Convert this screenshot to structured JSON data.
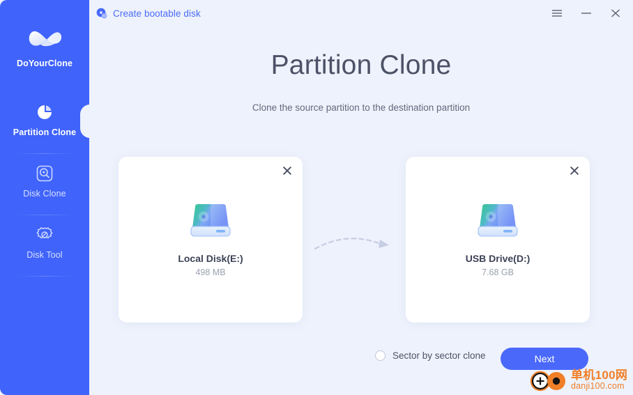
{
  "window": {
    "titlebar_action": {
      "icon": "iso-disc-icon",
      "label": "Create bootable disk"
    },
    "controls": [
      {
        "name": "menu-button",
        "icon": "hamburger-menu-icon"
      },
      {
        "name": "minimize-button",
        "icon": "minimize-icon"
      },
      {
        "name": "close-button",
        "icon": "close-icon"
      }
    ]
  },
  "sidebar": {
    "brand": {
      "name": "DoYourClone",
      "logo_icon": "infinity-ribbon-logo"
    },
    "background_color": "#3f63fb",
    "items": [
      {
        "label": "Partition Clone",
        "icon": "pie-chart-icon",
        "active": true
      },
      {
        "label": "Disk Clone",
        "icon": "disk-search-icon",
        "active": false
      },
      {
        "label": "Disk Tool",
        "icon": "gear-icon",
        "active": false
      }
    ]
  },
  "main": {
    "title": "Partition Clone",
    "subtitle": "Clone the source partition to the destination partition",
    "cards": [
      {
        "role": "source",
        "name": "Local Disk(E:)",
        "size": "498 MB",
        "icon": "hard-drive-icon",
        "close_icon": "close-icon"
      },
      {
        "role": "destination",
        "name": "USB Drive(D:)",
        "size": "7.68 GB",
        "icon": "hard-drive-icon",
        "close_icon": "close-icon"
      }
    ],
    "flow_arrow_icon": "dashed-curved-arrow-icon"
  },
  "footer": {
    "sector_option": {
      "label": "Sector by sector clone",
      "checked": false
    },
    "next_label": "Next"
  },
  "watermark": {
    "cn_text": "单机100网",
    "en_text": "danji100.com",
    "color": "#f07f28"
  },
  "colors": {
    "accent": "#4a69fb",
    "sidebar": "#3f63fb",
    "background": "#eef2fc",
    "card": "#ffffff",
    "title_text": "#4c5266"
  }
}
